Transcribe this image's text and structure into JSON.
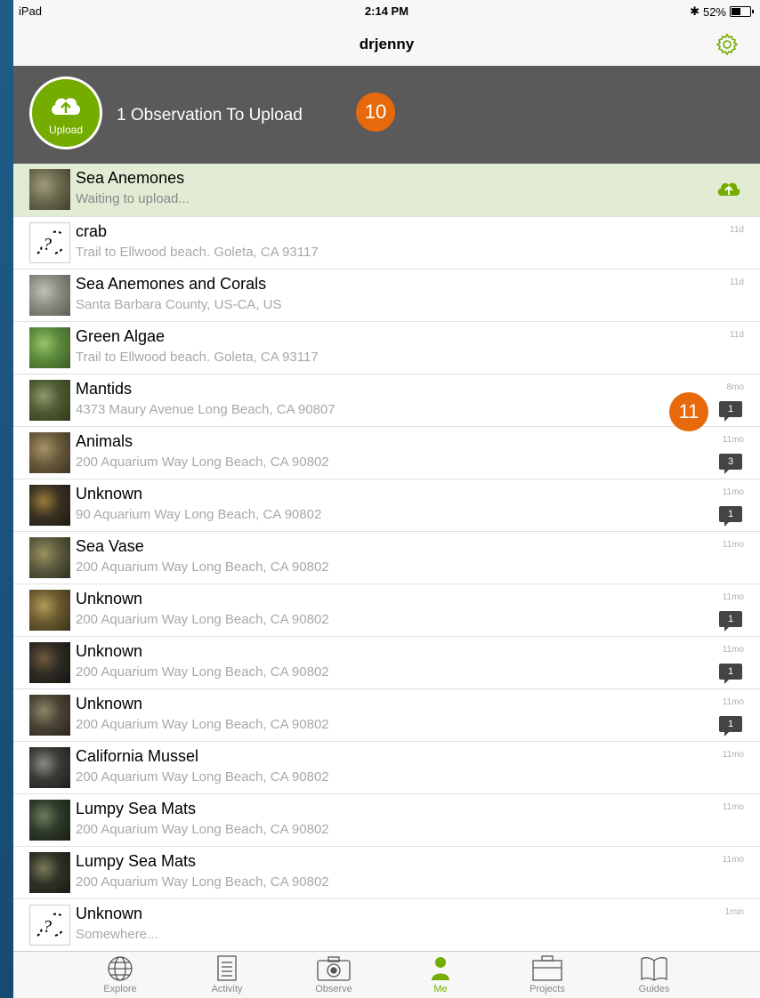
{
  "status": {
    "device": "iPad",
    "time": "2:14 PM",
    "battery": "52%",
    "battery_level": 0.52
  },
  "nav": {
    "title": "drjenny"
  },
  "upload": {
    "button_label": "Upload",
    "message": "1 Observation To Upload",
    "callout_a": "10",
    "callout_b": "11"
  },
  "observations": [
    {
      "name": "Sea Anemones",
      "sub": "Waiting to upload...",
      "time": "",
      "comments": "",
      "pending": true,
      "thumb": "photo"
    },
    {
      "name": "crab",
      "sub": "Trail to Ellwood beach. Goleta, CA 93117",
      "time": "11d",
      "comments": "",
      "thumb": "unknown"
    },
    {
      "name": "Sea Anemones and Corals",
      "sub": "Santa Barbara County, US-CA, US",
      "time": "11d",
      "comments": "",
      "thumb": "photo"
    },
    {
      "name": "Green Algae",
      "sub": "Trail to Ellwood beach. Goleta, CA 93117",
      "time": "11d",
      "comments": "",
      "thumb": "photo"
    },
    {
      "name": "Mantids",
      "sub": "4373 Maury Avenue Long Beach, CA 90807",
      "time": "8mo",
      "comments": "1",
      "thumb": "photo"
    },
    {
      "name": "Animals",
      "sub": "200 Aquarium Way Long Beach, CA 90802",
      "time": "11mo",
      "comments": "3",
      "thumb": "photo"
    },
    {
      "name": "Unknown",
      "sub": "90 Aquarium Way Long Beach, CA 90802",
      "time": "11mo",
      "comments": "1",
      "thumb": "photo"
    },
    {
      "name": "Sea Vase",
      "sub": "200 Aquarium Way Long Beach, CA 90802",
      "time": "11mo",
      "comments": "",
      "thumb": "photo"
    },
    {
      "name": "Unknown",
      "sub": "200 Aquarium Way Long Beach, CA 90802",
      "time": "11mo",
      "comments": "1",
      "thumb": "photo"
    },
    {
      "name": "Unknown",
      "sub": "200 Aquarium Way Long Beach, CA 90802",
      "time": "11mo",
      "comments": "1",
      "thumb": "photo"
    },
    {
      "name": "Unknown",
      "sub": "200 Aquarium Way Long Beach, CA 90802",
      "time": "11mo",
      "comments": "1",
      "thumb": "photo"
    },
    {
      "name": "California Mussel",
      "sub": "200 Aquarium Way Long Beach, CA 90802",
      "time": "11mo",
      "comments": "",
      "thumb": "photo"
    },
    {
      "name": "Lumpy Sea Mats",
      "sub": "200 Aquarium Way Long Beach, CA 90802",
      "time": "11mo",
      "comments": "",
      "thumb": "photo"
    },
    {
      "name": "Lumpy Sea Mats",
      "sub": "200 Aquarium Way Long Beach, CA 90802",
      "time": "11mo",
      "comments": "",
      "thumb": "photo"
    },
    {
      "name": "Unknown",
      "sub": "Somewhere...",
      "time": "1min",
      "comments": "",
      "thumb": "unknown"
    }
  ],
  "tabs": [
    {
      "label": "Explore",
      "icon": "globe-icon"
    },
    {
      "label": "Activity",
      "icon": "list-icon"
    },
    {
      "label": "Observe",
      "icon": "camera-icon"
    },
    {
      "label": "Me",
      "icon": "person-icon",
      "active": true
    },
    {
      "label": "Projects",
      "icon": "briefcase-icon"
    },
    {
      "label": "Guides",
      "icon": "book-icon"
    }
  ],
  "colors": {
    "accent": "#74ac00",
    "upload_bar": "#5a5a5a",
    "callout": "#e8690c",
    "pending_row": "#e2ecd4"
  }
}
